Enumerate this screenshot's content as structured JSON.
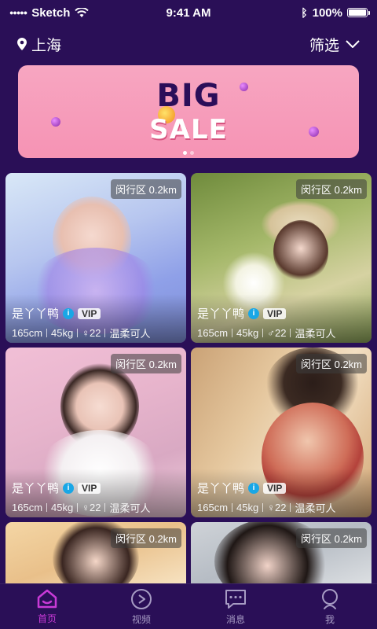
{
  "status_bar": {
    "carrier": "Sketch",
    "time": "9:41 AM",
    "battery": "100%"
  },
  "header": {
    "location": "上海",
    "filter_label": "筛选"
  },
  "banner": {
    "line1": "BIG",
    "line2": "SALE",
    "page_count": 2,
    "active_page": 1
  },
  "cards": [
    {
      "distance": "闵行区 0.2km",
      "name": "是丫丫鸭",
      "verified": "i",
      "vip": "VIP",
      "height": "165cm",
      "weight": "45kg",
      "gender_age": "♀22",
      "tag": "温柔可人"
    },
    {
      "distance": "闵行区 0.2km",
      "name": "是丫丫鸭",
      "verified": "i",
      "vip": "VIP",
      "height": "165cm",
      "weight": "45kg",
      "gender_age": "♂22",
      "tag": "温柔可人"
    },
    {
      "distance": "闵行区 0.2km",
      "name": "是丫丫鸭",
      "verified": "i",
      "vip": "VIP",
      "height": "165cm",
      "weight": "45kg",
      "gender_age": "♀22",
      "tag": "温柔可人"
    },
    {
      "distance": "闵行区 0.2km",
      "name": "是丫丫鸭",
      "verified": "i",
      "vip": "VIP",
      "height": "165cm",
      "weight": "45kg",
      "gender_age": "♀22",
      "tag": "温柔可人"
    },
    {
      "distance": "闵行区 0.2km"
    },
    {
      "distance": "闵行区 0.2km"
    }
  ],
  "tabs": [
    {
      "label": "首页",
      "icon": "home-icon",
      "active": true
    },
    {
      "label": "视频",
      "icon": "play-icon",
      "active": false
    },
    {
      "label": "消息",
      "icon": "message-icon",
      "active": false
    },
    {
      "label": "我",
      "icon": "profile-icon",
      "active": false
    }
  ],
  "colors": {
    "background": "#2a0f57",
    "accent": "#c93ad7",
    "verify": "#19a7e6"
  }
}
